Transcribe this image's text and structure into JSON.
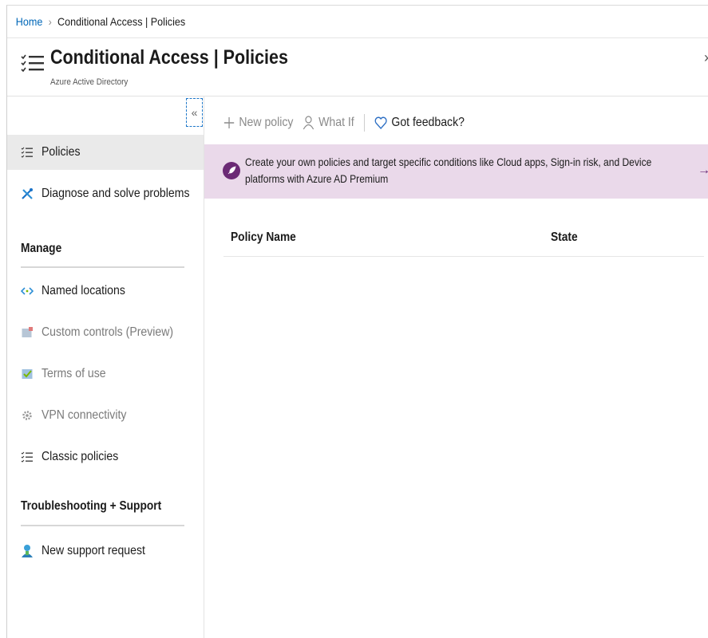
{
  "breadcrumb": {
    "home": "Home",
    "separator": "›",
    "current": "Conditional Access | Policies"
  },
  "header": {
    "title": "Conditional Access | Policies",
    "subtitle": "Azure Active Directory",
    "icon": "policy-list-icon",
    "close_icon": "close-icon",
    "close_glyph": "›"
  },
  "sidebar": {
    "collapse_glyph": "«",
    "items": [
      {
        "label": "Policies",
        "icon": "policy-list-icon",
        "active": true
      },
      {
        "label": "Diagnose and solve problems",
        "icon": "wrench-icon"
      }
    ],
    "sections": [
      {
        "title": "Manage",
        "items": [
          {
            "label": "Named locations",
            "icon": "named-locations-icon"
          },
          {
            "label": "Custom controls (Preview)",
            "icon": "custom-controls-icon",
            "disabled": true
          },
          {
            "label": "Terms of use",
            "icon": "terms-of-use-icon",
            "disabled": true
          },
          {
            "label": "VPN connectivity",
            "icon": "gear-icon",
            "disabled": true
          },
          {
            "label": "Classic policies",
            "icon": "policy-list-icon"
          }
        ]
      },
      {
        "title": "Troubleshooting + Support",
        "items": [
          {
            "label": "New support request",
            "icon": "support-person-icon"
          }
        ]
      }
    ]
  },
  "toolbar": {
    "new_policy": "New policy",
    "what_if": "What If",
    "feedback": "Got feedback?"
  },
  "banner": {
    "text": "Create your own policies and target specific conditions like Cloud apps, Sign-in risk, and Device platforms with Azure AD Premium",
    "icon": "rocket-icon",
    "arrow_glyph": "→"
  },
  "table": {
    "columns": [
      "Policy Name",
      "State"
    ],
    "rows": []
  },
  "colors": {
    "link": "#0067b8",
    "banner_bg": "#ead9ea",
    "banner_icon": "#6b2a75",
    "active_item_bg": "#eaeaea"
  }
}
